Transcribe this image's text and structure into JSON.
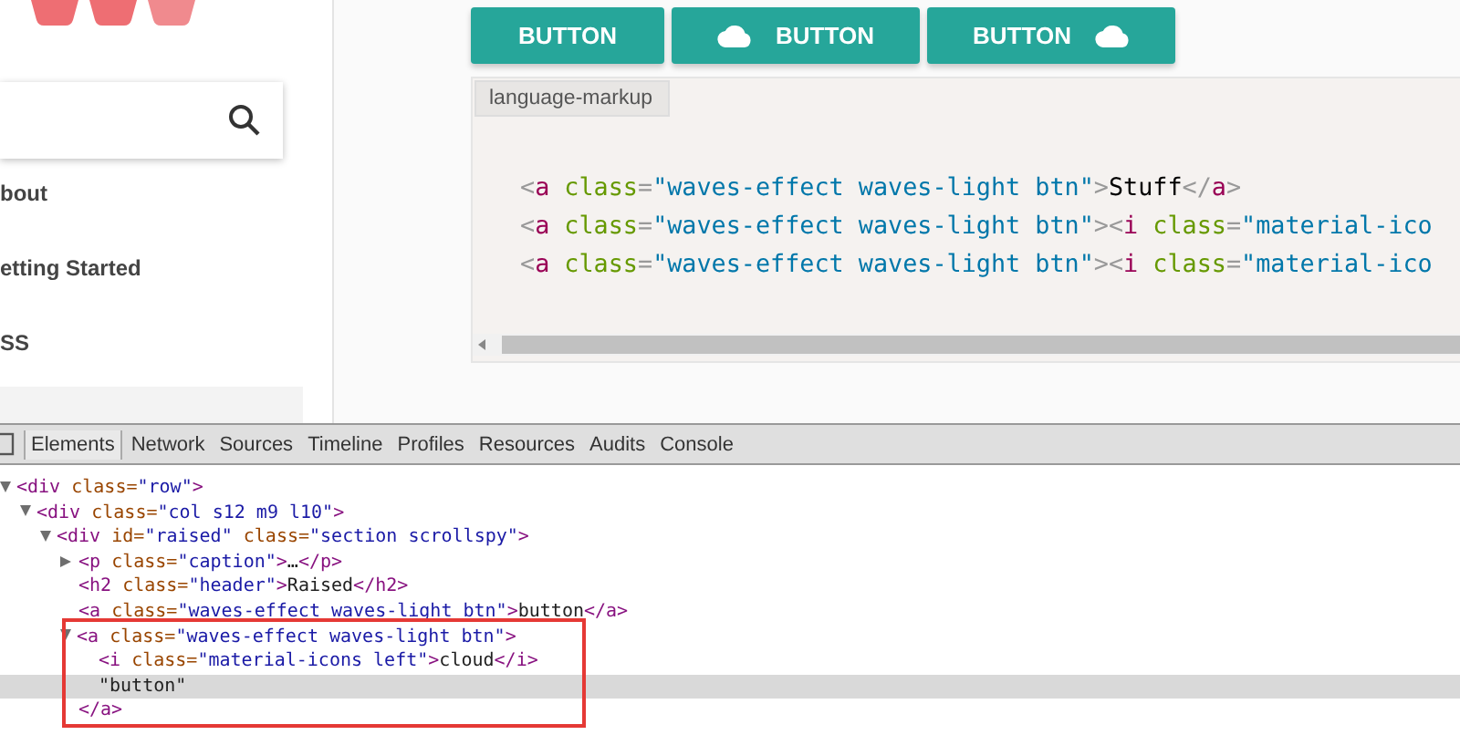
{
  "sidebar": {
    "items": [
      {
        "label": "bout",
        "selected": false
      },
      {
        "label": "etting Started",
        "selected": false
      },
      {
        "label": "SS",
        "selected": false
      }
    ]
  },
  "buttons": [
    {
      "label": "BUTTON",
      "kind": "text"
    },
    {
      "label": "BUTTON",
      "kind": "icon-left"
    },
    {
      "label": "BUTTON",
      "kind": "icon-right"
    }
  ],
  "code_block": {
    "language": "language-markup",
    "lines": [
      [
        {
          "kind": "punct",
          "text": "<"
        },
        {
          "kind": "tag",
          "text": "a"
        },
        {
          "kind": "attr",
          "text": " class"
        },
        {
          "kind": "punct",
          "text": "="
        },
        {
          "kind": "value",
          "text": "\"waves-effect waves-light btn\""
        },
        {
          "kind": "punct",
          "text": ">"
        },
        {
          "kind": "plain",
          "text": "Stuff"
        },
        {
          "kind": "punct",
          "text": "</"
        },
        {
          "kind": "tag",
          "text": "a"
        },
        {
          "kind": "punct",
          "text": ">"
        }
      ],
      [
        {
          "kind": "punct",
          "text": "<"
        },
        {
          "kind": "tag",
          "text": "a"
        },
        {
          "kind": "attr",
          "text": " class"
        },
        {
          "kind": "punct",
          "text": "="
        },
        {
          "kind": "value",
          "text": "\"waves-effect waves-light btn\""
        },
        {
          "kind": "punct",
          "text": "><"
        },
        {
          "kind": "tag",
          "text": "i"
        },
        {
          "kind": "attr",
          "text": " class"
        },
        {
          "kind": "punct",
          "text": "="
        },
        {
          "kind": "value",
          "text": "\"material-ico"
        }
      ],
      [
        {
          "kind": "punct",
          "text": "<"
        },
        {
          "kind": "tag",
          "text": "a"
        },
        {
          "kind": "attr",
          "text": " class"
        },
        {
          "kind": "punct",
          "text": "="
        },
        {
          "kind": "value",
          "text": "\"waves-effect waves-light btn\""
        },
        {
          "kind": "punct",
          "text": "><"
        },
        {
          "kind": "tag",
          "text": "i"
        },
        {
          "kind": "attr",
          "text": " class"
        },
        {
          "kind": "punct",
          "text": "="
        },
        {
          "kind": "value",
          "text": "\"material-ico"
        }
      ]
    ]
  },
  "devtools": {
    "tabs": [
      {
        "label": "Elements",
        "selected": true
      },
      {
        "label": "Network",
        "selected": false
      },
      {
        "label": "Sources",
        "selected": false
      },
      {
        "label": "Timeline",
        "selected": false
      },
      {
        "label": "Profiles",
        "selected": false
      },
      {
        "label": "Resources",
        "selected": false
      },
      {
        "label": "Audits",
        "selected": false
      },
      {
        "label": "Console",
        "selected": false
      }
    ],
    "tree": [
      {
        "kind": "parent",
        "expanded": true,
        "selected": false,
        "outlined": false,
        "line": [
          {
            "kind": "tag",
            "text": "<div"
          },
          {
            "kind": "attr",
            "text": " class="
          },
          {
            "kind": "value",
            "text": "\"row\""
          },
          {
            "kind": "tag",
            "text": ">"
          }
        ],
        "children": [
          {
            "kind": "parent",
            "expanded": true,
            "selected": false,
            "outlined": false,
            "line": [
              {
                "kind": "tag",
                "text": "<div"
              },
              {
                "kind": "attr",
                "text": " class="
              },
              {
                "kind": "value",
                "text": "\"col s12 m9 l10\""
              },
              {
                "kind": "tag",
                "text": ">"
              }
            ],
            "children": [
              {
                "kind": "parent",
                "expanded": true,
                "selected": false,
                "outlined": false,
                "line": [
                  {
                    "kind": "tag",
                    "text": "<div"
                  },
                  {
                    "kind": "attr",
                    "text": " id="
                  },
                  {
                    "kind": "value",
                    "text": "\"raised\""
                  },
                  {
                    "kind": "attr",
                    "text": " class="
                  },
                  {
                    "kind": "value",
                    "text": "\"section scrollspy\""
                  },
                  {
                    "kind": "tag",
                    "text": ">"
                  }
                ],
                "children": [
                  {
                    "kind": "parent",
                    "expanded": false,
                    "selected": false,
                    "outlined": false,
                    "line": [
                      {
                        "kind": "tag",
                        "text": "<p"
                      },
                      {
                        "kind": "attr",
                        "text": " class="
                      },
                      {
                        "kind": "value",
                        "text": "\"caption\""
                      },
                      {
                        "kind": "tag",
                        "text": ">"
                      },
                      {
                        "kind": "plain",
                        "text": "…"
                      },
                      {
                        "kind": "tag",
                        "text": "</p>"
                      }
                    ]
                  },
                  {
                    "kind": "leaf",
                    "selected": false,
                    "outlined": false,
                    "line": [
                      {
                        "kind": "tag",
                        "text": "<h2"
                      },
                      {
                        "kind": "attr",
                        "text": " class="
                      },
                      {
                        "kind": "value",
                        "text": "\"header\""
                      },
                      {
                        "kind": "tag",
                        "text": ">"
                      },
                      {
                        "kind": "plain",
                        "text": "Raised"
                      },
                      {
                        "kind": "tag",
                        "text": "</h2>"
                      }
                    ]
                  },
                  {
                    "kind": "leaf",
                    "selected": false,
                    "outlined": false,
                    "line": [
                      {
                        "kind": "tag",
                        "text": "<a"
                      },
                      {
                        "kind": "attr",
                        "text": " class="
                      },
                      {
                        "kind": "value",
                        "text": "\"waves-effect waves-light btn\""
                      },
                      {
                        "kind": "tag",
                        "text": ">"
                      },
                      {
                        "kind": "plain",
                        "text": "button"
                      },
                      {
                        "kind": "tag",
                        "text": "</a>"
                      }
                    ]
                  },
                  {
                    "kind": "parent",
                    "expanded": true,
                    "selected": false,
                    "outlined": true,
                    "line": [
                      {
                        "kind": "tag",
                        "text": "<a"
                      },
                      {
                        "kind": "attr",
                        "text": " class="
                      },
                      {
                        "kind": "value",
                        "text": "\"waves-effect waves-light btn\""
                      },
                      {
                        "kind": "tag",
                        "text": ">"
                      }
                    ],
                    "closing": [
                      {
                        "kind": "tag",
                        "text": "</a>"
                      }
                    ],
                    "children": [
                      {
                        "kind": "leaf",
                        "selected": false,
                        "outlined": false,
                        "line": [
                          {
                            "kind": "tag",
                            "text": "<i"
                          },
                          {
                            "kind": "attr",
                            "text": " class="
                          },
                          {
                            "kind": "value",
                            "text": "\"material-icons left\""
                          },
                          {
                            "kind": "tag",
                            "text": ">"
                          },
                          {
                            "kind": "plain",
                            "text": "cloud"
                          },
                          {
                            "kind": "tag",
                            "text": "</i>"
                          }
                        ]
                      },
                      {
                        "kind": "leaf",
                        "selected": true,
                        "outlined": false,
                        "line": [
                          {
                            "kind": "plain",
                            "text": "\"button\""
                          }
                        ]
                      }
                    ]
                  }
                ]
              }
            ]
          }
        ]
      }
    ]
  }
}
